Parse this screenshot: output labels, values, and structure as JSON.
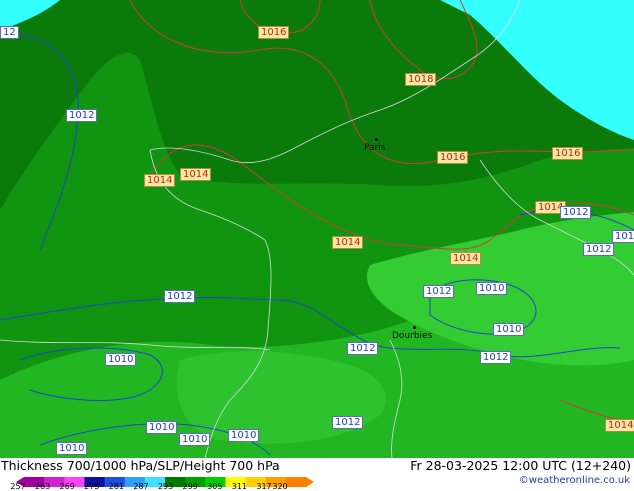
{
  "footer": {
    "title": "Thickness 700/1000 hPa/SLP/Height 700 hPa",
    "datetime": "Fr 28-03-2025 12:00 UTC (12+240)",
    "brand": "©weatheronline.co.uk"
  },
  "legend": {
    "ticks": [
      "257",
      "263",
      "269",
      "275",
      "281",
      "287",
      "293",
      "299",
      "305",
      "311",
      "317",
      "320"
    ],
    "colors": [
      "#a000a0",
      "#d020d0",
      "#ff40ff",
      "#1010a0",
      "#2050e0",
      "#30a0ff",
      "#40e0ff",
      "#007a00",
      "#00a000",
      "#00d000",
      "#ffff00",
      "#ffd000",
      "#ffa000",
      "#ff8000"
    ]
  },
  "map_colors": {
    "sea": "#33ffff",
    "dark_green": "#0a7a0a",
    "mid_green": "#119511",
    "light_green": "#22b622",
    "bright_green": "#33cc33",
    "isobar_red": "#d03a3a",
    "isobar_blue": "#2244cc",
    "border": "#d8d8d8"
  },
  "isobar_labels": [
    {
      "text": "1016",
      "color": "red"
    },
    {
      "text": "1016",
      "color": "red"
    },
    {
      "text": "1016",
      "color": "red"
    },
    {
      "text": "1016",
      "color": "red"
    },
    {
      "text": "1014",
      "color": "red"
    },
    {
      "text": "1014",
      "color": "red"
    },
    {
      "text": "1014",
      "color": "red"
    },
    {
      "text": "1014",
      "color": "red"
    },
    {
      "text": "1014",
      "color": "red"
    },
    {
      "text": "1014",
      "color": "red"
    },
    {
      "text": "1014",
      "color": "red"
    },
    {
      "text": "1012",
      "color": "blue"
    },
    {
      "text": "1012",
      "color": "blue"
    },
    {
      "text": "1012",
      "color": "blue"
    },
    {
      "text": "1012",
      "color": "blue"
    },
    {
      "text": "1012",
      "color": "blue"
    },
    {
      "text": "1012",
      "color": "blue"
    },
    {
      "text": "1012",
      "color": "blue"
    },
    {
      "text": "1012",
      "color": "blue"
    },
    {
      "text": "1012",
      "color": "blue"
    },
    {
      "text": "1010",
      "color": "blue"
    },
    {
      "text": "1010",
      "color": "blue"
    },
    {
      "text": "1010",
      "color": "blue"
    },
    {
      "text": "1010",
      "color": "blue"
    },
    {
      "text": "1010",
      "color": "blue"
    },
    {
      "text": "1010",
      "color": "blue"
    },
    {
      "text": "1010",
      "color": "blue"
    },
    {
      "text": "1012",
      "color": "blue"
    },
    {
      "text": "12",
      "color": "blue"
    },
    {
      "text": "1018",
      "color": "red"
    }
  ],
  "cities": [
    {
      "name": "Paris"
    },
    {
      "name": "Dourbies"
    }
  ]
}
